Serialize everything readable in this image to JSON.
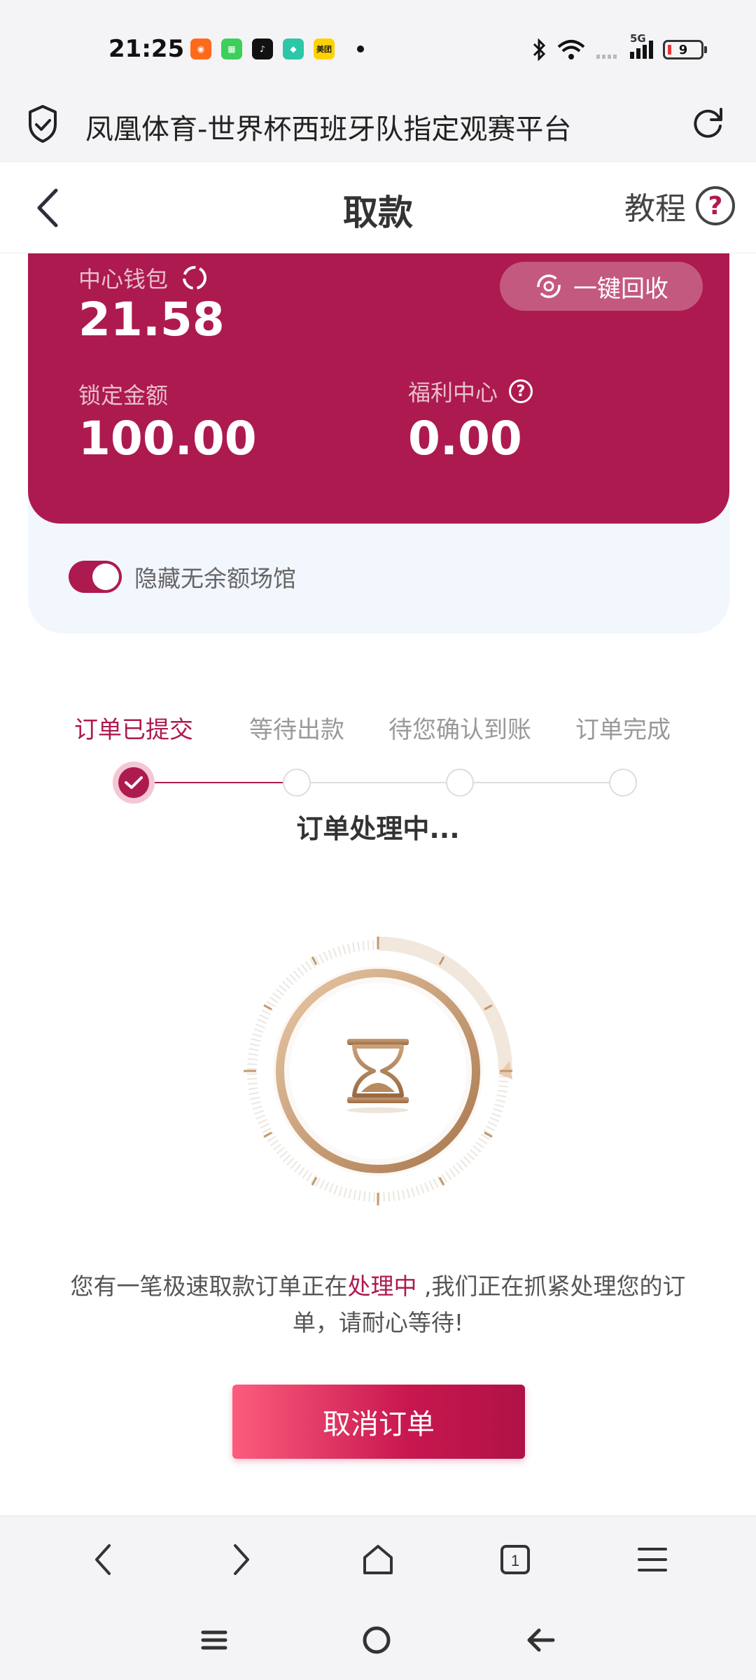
{
  "status_bar": {
    "time": "21:25",
    "network": "5G",
    "battery": "9",
    "apps": [
      {
        "icon": "app-orange-icon",
        "color": "#ff6a1a"
      },
      {
        "icon": "app-green-icon",
        "color": "#3ccf5a"
      },
      {
        "icon": "tiktok-icon",
        "color": "#111111"
      },
      {
        "icon": "app-teal-icon",
        "color": "#2bc7a6"
      },
      {
        "icon": "meituan-icon",
        "color": "#ffd100",
        "label": "美团"
      }
    ]
  },
  "browser": {
    "page_title": "凤凰体育-世界杯西班牙队指定观赛平台"
  },
  "header": {
    "title": "取款",
    "tutorial_label": "教程"
  },
  "wallet": {
    "center_wallet_label": "中心钱包",
    "center_wallet_value": "21.58",
    "recycle_label": "一键回收",
    "locked_label": "锁定金额",
    "locked_value": "100.00",
    "welfare_label": "福利中心",
    "welfare_value": "0.00",
    "hide_empty_label": "隐藏无余额场馆",
    "hide_empty_on": true
  },
  "steps": {
    "items": [
      "订单已提交",
      "等待出款",
      "待您确认到账",
      "订单完成"
    ],
    "current_index": 0,
    "status": "订单处理中..."
  },
  "message": {
    "part1": "您有一笔极速取款订单正在",
    "highlight": "处理中",
    "part2": " ,我们正在抓紧处理您的订单，请耐心等待!"
  },
  "actions": {
    "cancel_label": "取消订单"
  },
  "colors": {
    "brand": "#ad1a4f",
    "card_bg": "#f2f6fd",
    "gold": "#c49a6c"
  }
}
